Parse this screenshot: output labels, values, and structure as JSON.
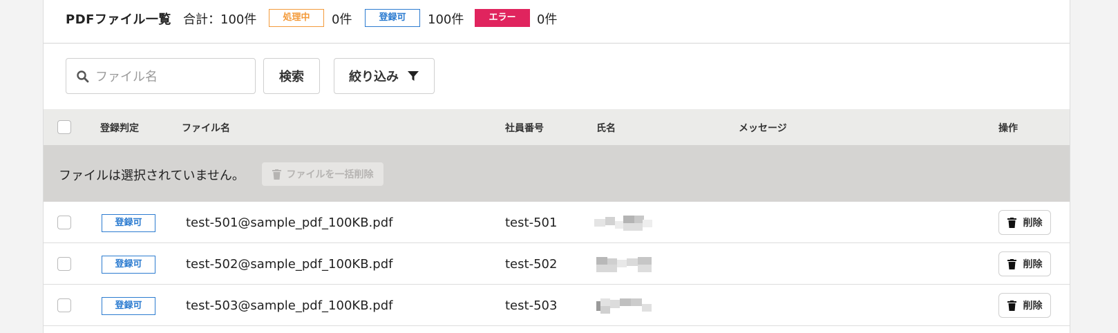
{
  "header": {
    "title": "PDFファイル一覧",
    "total": "合計：100件",
    "statuses": [
      {
        "label": "処理中",
        "count": "0件",
        "color": "#f39a3a"
      },
      {
        "label": "登録可",
        "count": "100件",
        "color": "#2b7bd0"
      },
      {
        "label": "エラー",
        "count": "0件",
        "color": "#e0245e"
      }
    ]
  },
  "toolbar": {
    "search_placeholder": "ファイル名",
    "search_value": "",
    "search_button": "検索",
    "filter_button": "絞り込み",
    "search_icon": "search-icon",
    "filter_icon": "filter-icon"
  },
  "table": {
    "columns": [
      "登録判定",
      "ファイル名",
      "社員番号",
      "氏名",
      "メッセージ",
      "操作"
    ],
    "empty_selection_text": "ファイルは選択されていません。",
    "bulk_delete_label": "ファイルを一括削除",
    "rows": [
      {
        "status": "登録可",
        "file_name": "test-501@sample_pdf_100KB.pdf",
        "employee_no": "test-501",
        "name": "",
        "message": "",
        "action": "削除"
      },
      {
        "status": "登録可",
        "file_name": "test-502@sample_pdf_100KB.pdf",
        "employee_no": "test-502",
        "name": "",
        "message": "",
        "action": "削除"
      },
      {
        "status": "登録可",
        "file_name": "test-503@sample_pdf_100KB.pdf",
        "employee_no": "test-503",
        "name": "",
        "message": "",
        "action": "削除"
      }
    ]
  }
}
